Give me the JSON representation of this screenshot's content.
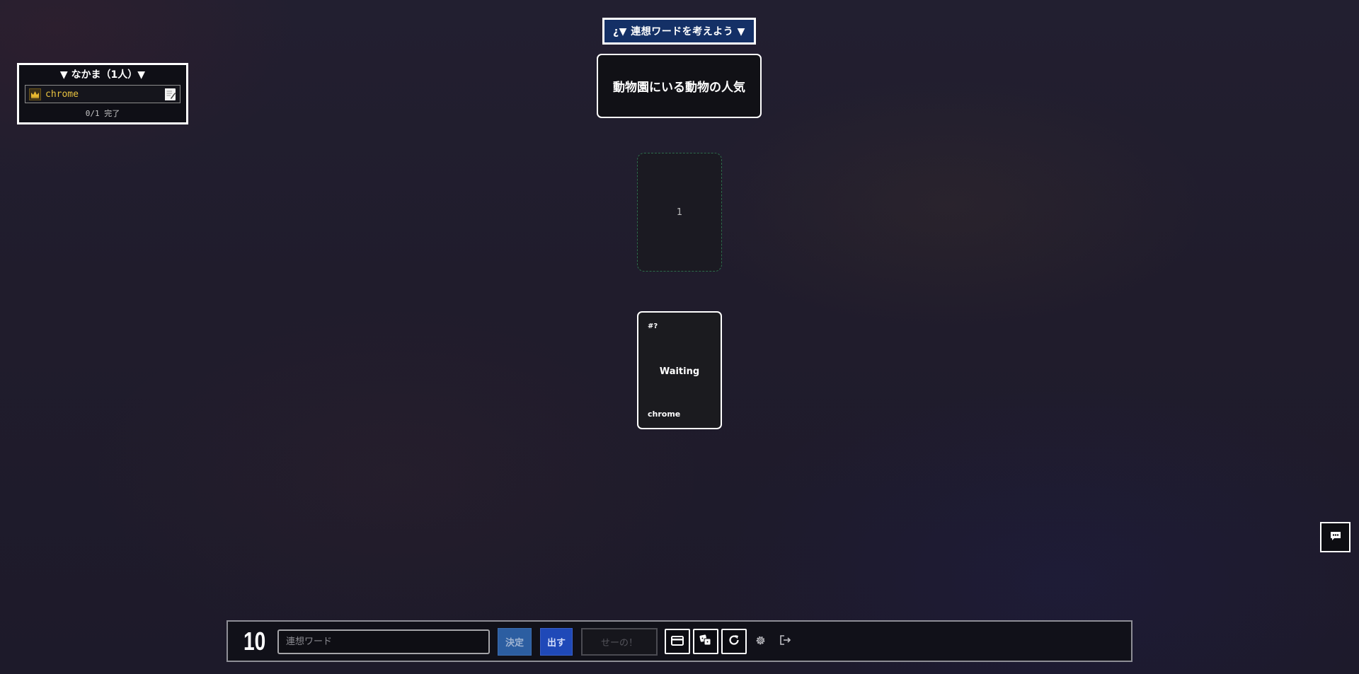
{
  "phase": {
    "label": "¿▼ 連想ワードを考えよう ▼"
  },
  "topic": {
    "text": "動物園にいる動物の人気"
  },
  "party": {
    "title": "▼ なかま（1人）▼",
    "members": [
      {
        "name": "chrome",
        "role_icon": "crown-icon",
        "status_icon": "memo-icon",
        "name_color": "#e8c240"
      }
    ],
    "progress": "0/1 完了"
  },
  "slot": {
    "number": "1"
  },
  "player_card": {
    "number": "#?",
    "status": "Waiting",
    "owner": "chrome"
  },
  "controls": {
    "count": "10",
    "word_input": {
      "placeholder": "連想ワード",
      "value": ""
    },
    "confirm_label": "決定",
    "play_label": "出す",
    "reveal_label": "せーの！",
    "icons": [
      "card-icon",
      "dice-icon",
      "refresh-icon",
      "gear-icon",
      "exit-icon"
    ]
  },
  "chat": {
    "icon": "chat-icon"
  },
  "colors": {
    "background": "#201c2c",
    "banner": "#143066",
    "confirm_button": "#2c5ea1",
    "play_button": "#1f49b8",
    "slot_border": "#2e6b4c"
  }
}
